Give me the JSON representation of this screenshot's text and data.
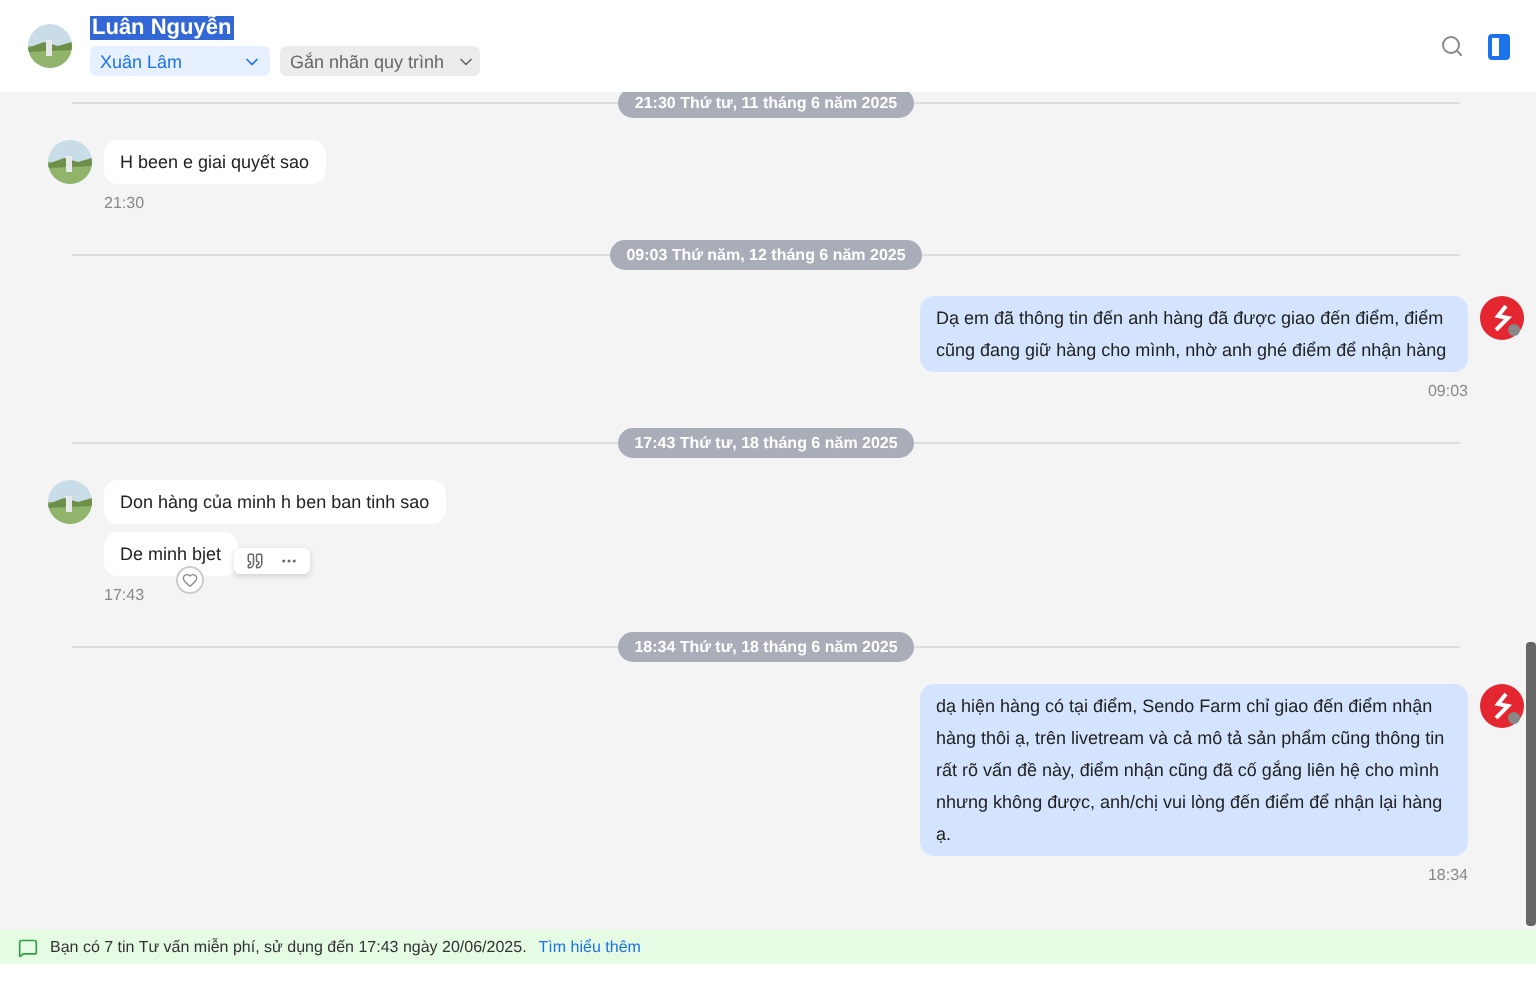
{
  "header": {
    "name": "Luân Nguyễn",
    "name_highlighted": true,
    "assignee": "Xuân Lâm",
    "label_select": "Gắn nhãn quy trình"
  },
  "messages": [
    {
      "kind": "divider",
      "text": "21:30 Thứ tư, 11 tháng 6 năm 2025"
    },
    {
      "kind": "incoming",
      "bubbles": [
        {
          "text": "H been e giai quyết sao"
        }
      ],
      "time": "21:30"
    },
    {
      "kind": "divider",
      "text": "09:03 Thứ năm, 12 tháng 6 năm 2025"
    },
    {
      "kind": "outgoing",
      "bubbles": [
        {
          "text": "Dạ em đã thông tin đến anh hàng đã được giao đến điểm, điểm cũng đang giữ hàng cho mình, nhờ anh ghé điểm để nhận hàng"
        }
      ],
      "time": "09:03"
    },
    {
      "kind": "divider",
      "text": "17:43 Thứ tư, 18 tháng 6 năm 2025"
    },
    {
      "kind": "incoming",
      "bubbles": [
        {
          "text": "Don hàng của minh h ben ban tinh sao"
        },
        {
          "text": "De minh bjet",
          "hovered": true
        }
      ],
      "time": "17:43"
    },
    {
      "kind": "divider",
      "text": "18:34 Thứ tư, 18 tháng 6 năm 2025"
    },
    {
      "kind": "outgoing",
      "bubbles": [
        {
          "text": "dạ hiện hàng có tại điểm, Sendo Farm chỉ giao đến điểm nhận hàng thôi ạ, trên livetream và cả mô tả sản phẩm cũng thông tin rất rõ vấn đề này, điểm nhận cũng đã cố gắng liên hệ cho mình nhưng không được, anh/chị vui lòng đến điểm để nhận lại hàng ạ."
        }
      ],
      "time": "18:34"
    }
  ],
  "banner": {
    "text": "Bạn có 7 tin Tư vấn miễn phí, sử dụng đến 17:43 ngày 20/06/2025.",
    "link": "Tìm hiểu thêm"
  }
}
